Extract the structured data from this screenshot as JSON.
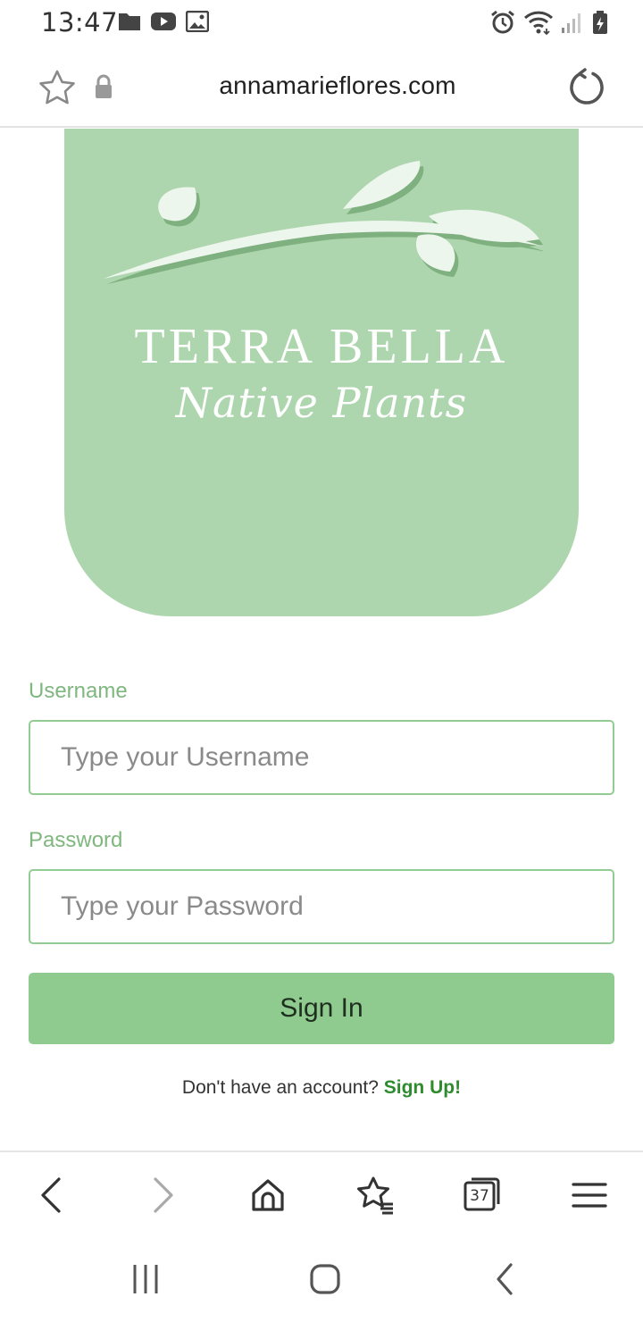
{
  "status_bar": {
    "time": "13:47",
    "left_icons": [
      "folder-icon",
      "youtube-icon",
      "image-icon"
    ],
    "right_icons": [
      "alarm-icon",
      "wifi-icon",
      "signal-icon",
      "battery-icon"
    ]
  },
  "browser": {
    "url": "annamarieflores.com",
    "tabs_count": "37"
  },
  "logo": {
    "title": "TERRA BELLA",
    "subtitle": "Native Plants",
    "background_color": "#aed6ae"
  },
  "form": {
    "username_label": "Username",
    "username_placeholder": "Type your Username",
    "password_label": "Password",
    "password_placeholder": "Type your Password",
    "signin_label": "Sign In",
    "signup_prompt": "Don't have an account? ",
    "signup_link": "Sign Up!"
  },
  "colors": {
    "accent": "#8fcb8f",
    "label": "#7fb77f",
    "link": "#2e8b2e"
  }
}
